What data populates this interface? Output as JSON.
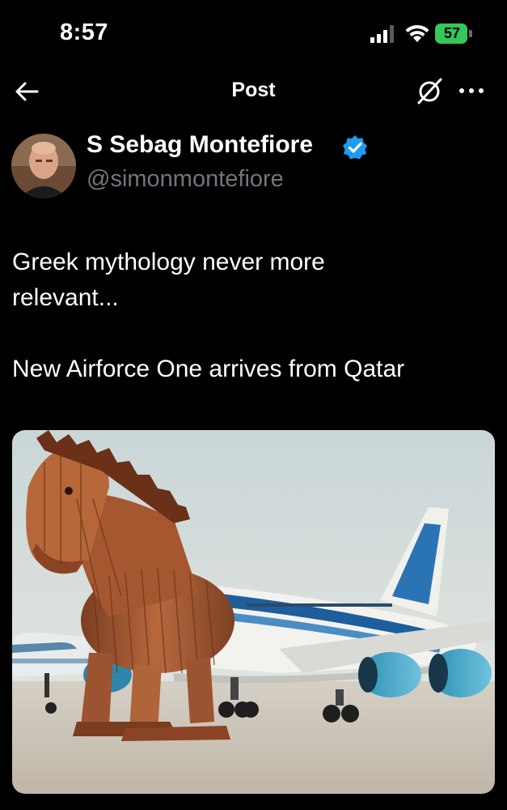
{
  "status_bar": {
    "time": "8:57",
    "battery_percent": "57",
    "battery_color": "#34c759"
  },
  "nav": {
    "title": "Post"
  },
  "author": {
    "name": "S Sebag Montefiore",
    "handle": "@simonmontefiore",
    "verified": true,
    "verified_color": "#1d9bf0"
  },
  "post": {
    "text_line_1": "Greek mythology never more",
    "text_line_2": "relevant...",
    "text_line_3": "New Airforce One arrives from Qatar"
  },
  "media": {
    "type": "image",
    "subject": "wooden-trojan-horse-and-blue-white-airplane"
  }
}
